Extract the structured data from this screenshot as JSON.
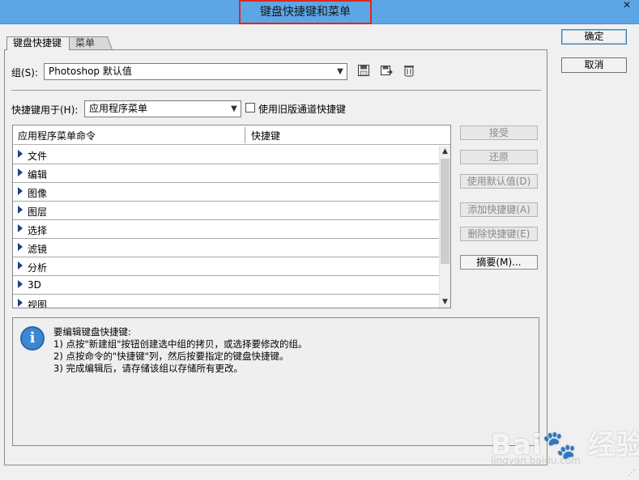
{
  "window": {
    "title": "键盘快捷键和菜单",
    "close": "✕"
  },
  "tabs": [
    {
      "label": "键盘快捷键"
    },
    {
      "label": "菜单"
    }
  ],
  "set": {
    "label": "组(S):",
    "value": "Photoshop 默认值"
  },
  "shortcuts_for": {
    "label": "快捷键用于(H):",
    "value": "应用程序菜单"
  },
  "legacy_channel": {
    "label": "使用旧版通道快捷键",
    "checked": false
  },
  "table": {
    "col_command": "应用程序菜单命令",
    "col_shortcut": "快捷键",
    "rows": [
      "文件",
      "编辑",
      "图像",
      "图层",
      "选择",
      "滤镜",
      "分析",
      "3D",
      "视图"
    ]
  },
  "side_buttons": {
    "accept": "接受",
    "undo": "还原",
    "use_default": "使用默认值(D)",
    "add_shortcut": "添加快捷键(A)",
    "delete_shortcut": "删除快捷键(E)",
    "summarize": "摘要(M)..."
  },
  "info": {
    "icon": "i",
    "lines": [
      "要编辑键盘快捷键:",
      "1) 点按\"新建组\"按钮创建选中组的拷贝，或选择要修改的组。",
      "2) 点按命令的\"快捷键\"列，然后按要指定的键盘快捷键。",
      "3) 完成编辑后，请存储该组以存储所有更改。"
    ]
  },
  "dialog": {
    "ok": "确定",
    "cancel": "取消"
  },
  "watermark": {
    "brand": "Bai🐾 经验",
    "url": "jingyan.baidu.com"
  },
  "icons": {
    "save": "save-icon",
    "save_as": "save-as-icon",
    "delete": "trash-icon"
  },
  "colors": {
    "titlebar": "#5da6e6",
    "highlight": "#e0271b",
    "tree_arrow": "#1d3f82",
    "info_icon": "#3f86d1"
  }
}
